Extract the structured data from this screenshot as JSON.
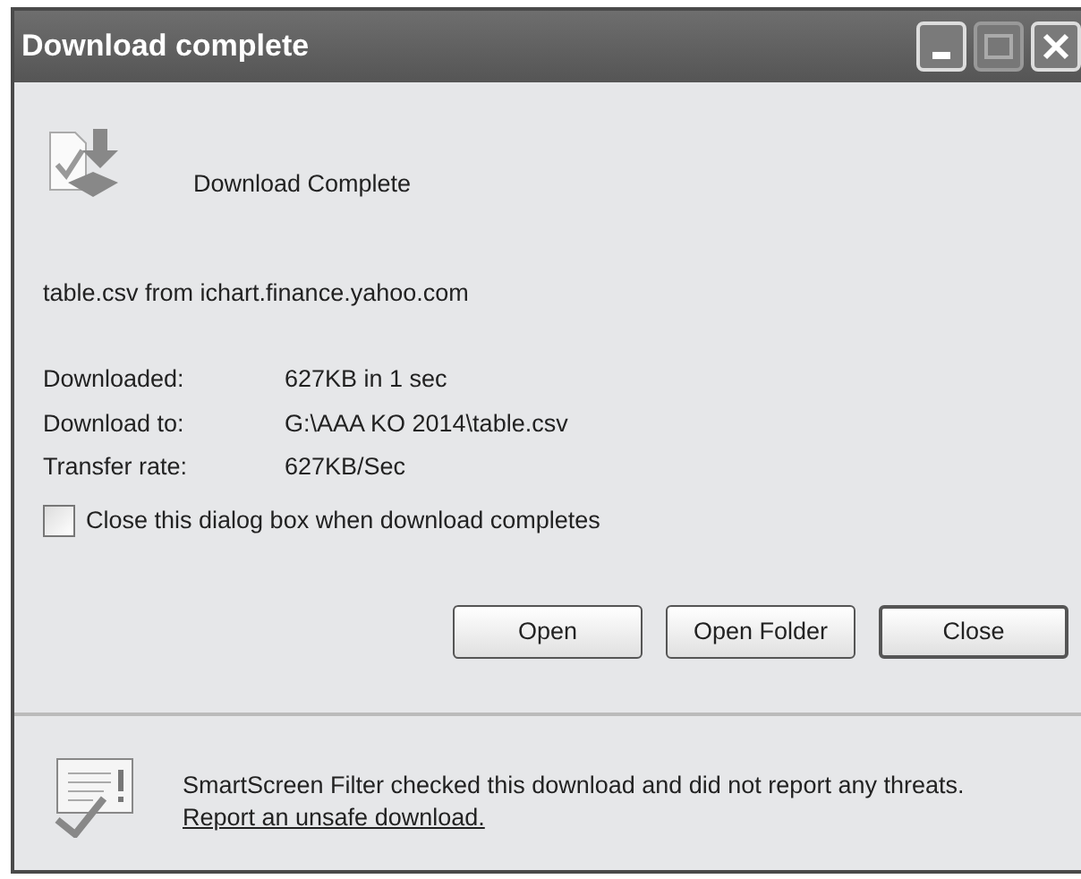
{
  "window": {
    "title": "Download complete"
  },
  "heading": "Download Complete",
  "source": "table.csv from ichart.finance.yahoo.com",
  "details": [
    {
      "label": "Downloaded:",
      "value": "627KB in 1 sec"
    },
    {
      "label": "Download to:",
      "value": "G:\\AAA KO 2014\\table.csv"
    },
    {
      "label": "Transfer rate:",
      "value": "627KB/Sec"
    }
  ],
  "close_when_done": {
    "label": "Close this dialog box when download completes",
    "checked": false
  },
  "buttons": [
    {
      "label": "Open",
      "default": false
    },
    {
      "label": "Open Folder",
      "default": false
    },
    {
      "label": "Close",
      "default": true
    }
  ],
  "smartscreen": {
    "text": "SmartScreen Filter checked this download and did not report any threats.",
    "link": "Report an unsafe download."
  }
}
